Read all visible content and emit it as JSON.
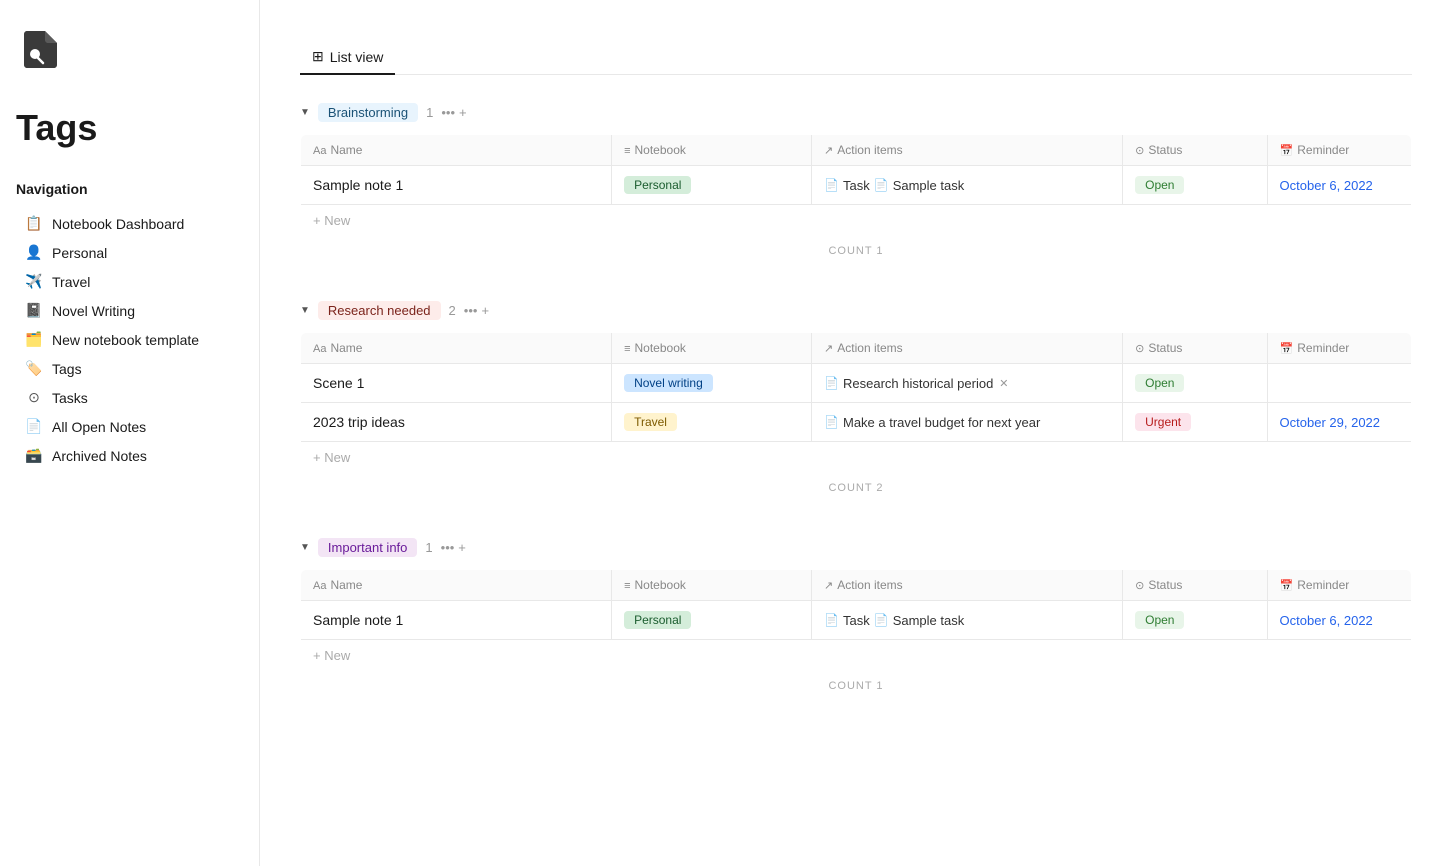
{
  "sidebar": {
    "title": "Tags",
    "navigation_heading": "Navigation",
    "nav_items": [
      {
        "id": "notebook-dashboard",
        "label": "Notebook Dashboard",
        "icon": "📋"
      },
      {
        "id": "personal",
        "label": "Personal",
        "icon": "👤"
      },
      {
        "id": "travel",
        "label": "Travel",
        "icon": "✈️"
      },
      {
        "id": "novel-writing",
        "label": "Novel Writing",
        "icon": "📓"
      },
      {
        "id": "new-notebook-template",
        "label": "New notebook template",
        "icon": "🗂️"
      },
      {
        "id": "tags",
        "label": "Tags",
        "icon": "🏷️"
      },
      {
        "id": "tasks",
        "label": "Tasks",
        "icon": "⊙"
      },
      {
        "id": "all-open-notes",
        "label": "All Open Notes",
        "icon": "📄"
      },
      {
        "id": "archived-notes",
        "label": "Archived Notes",
        "icon": "🗃️"
      }
    ]
  },
  "view": {
    "tab_label": "List view",
    "tab_icon": "⊞"
  },
  "groups": [
    {
      "id": "brainstorming",
      "tag": "Brainstorming",
      "tag_class": "tag-brainstorming",
      "count": 1,
      "count_label": "COUNT 1",
      "columns": {
        "name": "Name",
        "notebook": "Notebook",
        "action_items": "Action items",
        "status": "Status",
        "reminder": "Reminder"
      },
      "rows": [
        {
          "name": "Sample note 1",
          "notebook": "Personal",
          "notebook_class": "nb-green",
          "action_items": [
            {
              "icon": "📄",
              "label": "Task"
            },
            {
              "icon": "📄",
              "label": "Sample task"
            }
          ],
          "status": "Open",
          "status_class": "status-open",
          "reminder": "October 6, 2022"
        }
      ]
    },
    {
      "id": "research-needed",
      "tag": "Research needed",
      "tag_class": "tag-research",
      "count": 2,
      "count_label": "COUNT 2",
      "columns": {
        "name": "Name",
        "notebook": "Notebook",
        "action_items": "Action items",
        "status": "Status",
        "reminder": "Reminder"
      },
      "rows": [
        {
          "name": "Scene 1",
          "notebook": "Novel writing",
          "notebook_class": "nb-blue",
          "action_items": [
            {
              "icon": "📄",
              "label": "Research historical period",
              "has_x": true
            }
          ],
          "status": "Open",
          "status_class": "status-open",
          "reminder": ""
        },
        {
          "name": "2023 trip ideas",
          "notebook": "Travel",
          "notebook_class": "nb-yellow",
          "action_items": [
            {
              "icon": "📄",
              "label": "Make a travel budget for next year"
            }
          ],
          "status": "Urgent",
          "status_class": "status-urgent",
          "reminder": "October 29, 2022"
        }
      ]
    },
    {
      "id": "important-info",
      "tag": "Important info",
      "tag_class": "tag-important",
      "count": 1,
      "count_label": "COUNT 1",
      "columns": {
        "name": "Name",
        "notebook": "Notebook",
        "action_items": "Action items",
        "status": "Status",
        "reminder": "Reminder"
      },
      "rows": [
        {
          "name": "Sample note 1",
          "notebook": "Personal",
          "notebook_class": "nb-green",
          "action_items": [
            {
              "icon": "📄",
              "label": "Task"
            },
            {
              "icon": "📄",
              "label": "Sample task"
            }
          ],
          "status": "Open",
          "status_class": "status-open",
          "reminder": "October 6, 2022"
        }
      ]
    }
  ],
  "new_label": "+ New"
}
